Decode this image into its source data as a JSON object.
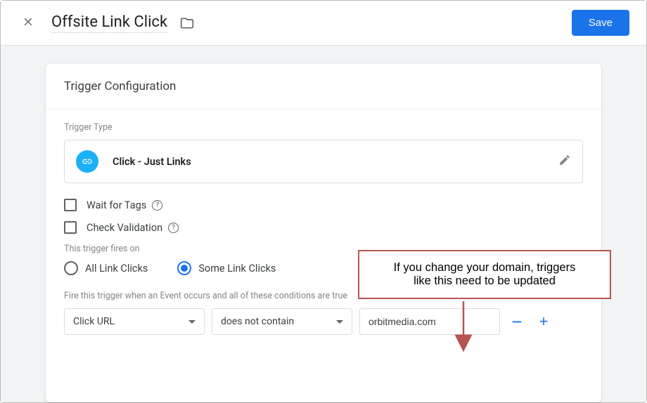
{
  "header": {
    "title": "Offsite Link Click",
    "save_label": "Save"
  },
  "card": {
    "title": "Trigger Configuration",
    "trigger_type_label": "Trigger Type",
    "trigger_type_value": "Click - Just Links",
    "wait_for_tags_label": "Wait for Tags",
    "check_validation_label": "Check Validation",
    "fires_on_label": "This trigger fires on",
    "radio_all_label": "All Link Clicks",
    "radio_some_label": "Some Link Clicks",
    "fire_conditions_label": "Fire this trigger when an Event occurs and all of these conditions are true",
    "condition": {
      "variable": "Click URL",
      "operator": "does not contain",
      "value": "orbitmedia.com"
    }
  },
  "callout": {
    "line1": "If you change your domain, triggers",
    "line2": "like this need to be updated"
  }
}
